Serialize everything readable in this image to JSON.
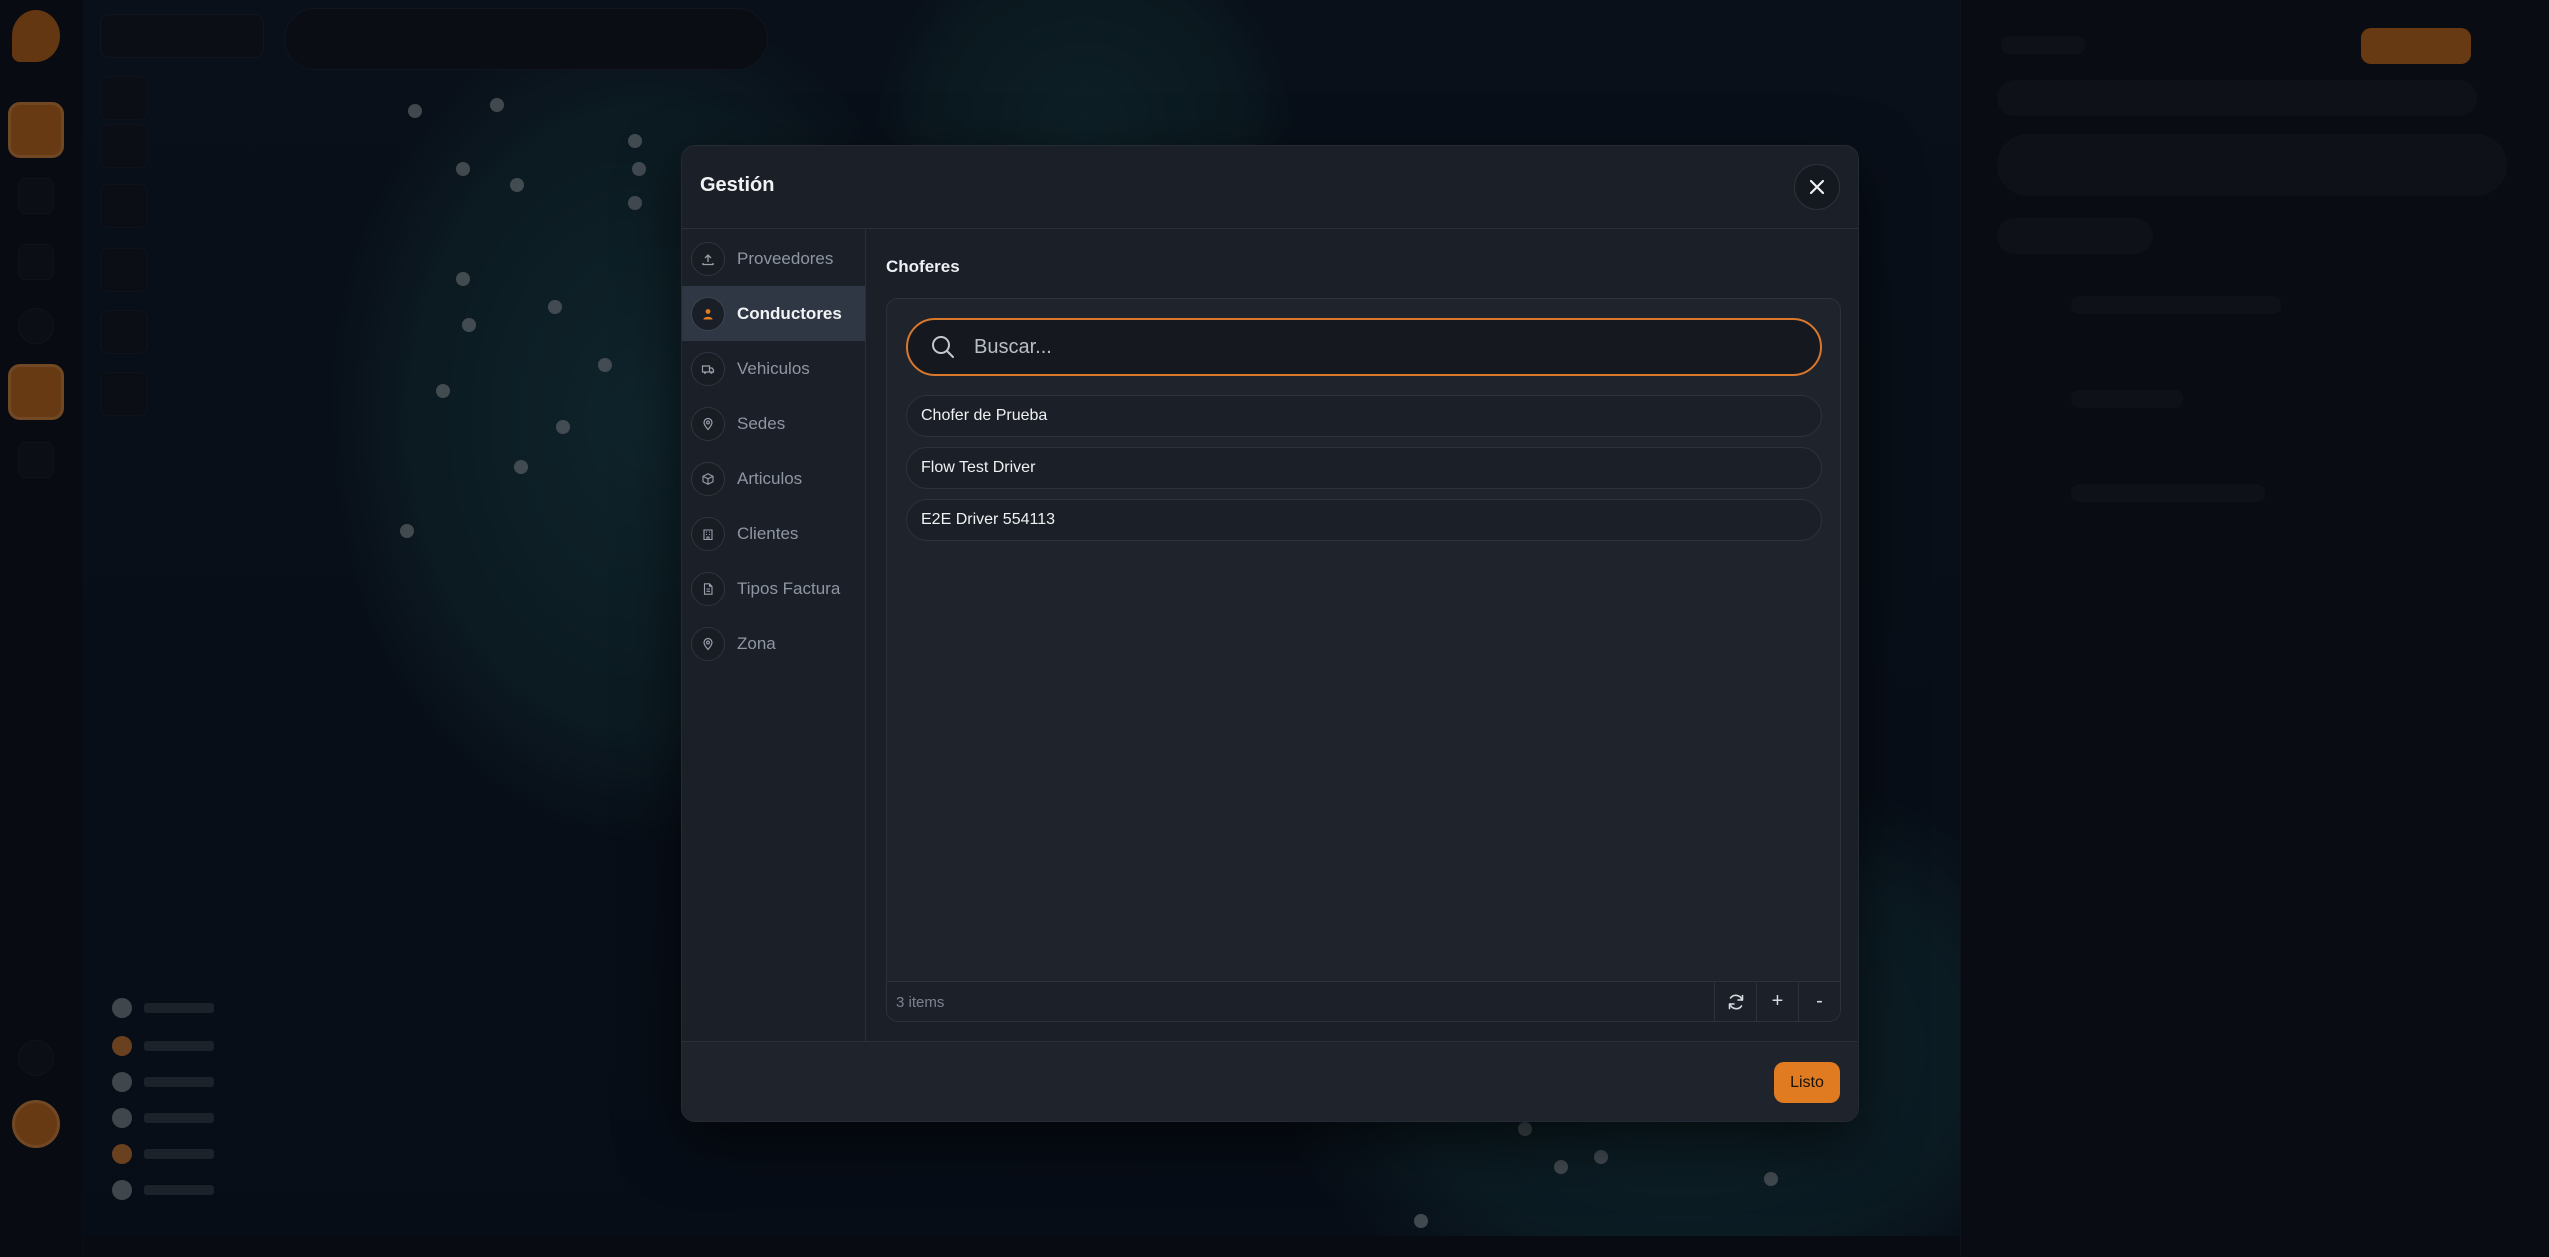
{
  "modal": {
    "title": "Gestión",
    "close_icon": "close-icon",
    "nav": [
      {
        "label": "Proveedores",
        "icon": "upload-icon",
        "active": false
      },
      {
        "label": "Conductores",
        "icon": "person-icon",
        "active": true
      },
      {
        "label": "Vehiculos",
        "icon": "truck-icon",
        "active": false
      },
      {
        "label": "Sedes",
        "icon": "location-pin-icon",
        "active": false
      },
      {
        "label": "Articulos",
        "icon": "box-icon",
        "active": false
      },
      {
        "label": "Clientes",
        "icon": "building-icon",
        "active": false
      },
      {
        "label": "Tipos Factura",
        "icon": "document-icon",
        "active": false
      },
      {
        "label": "Zona",
        "icon": "location-pin-icon",
        "active": false
      }
    ],
    "section_title": "Choferes",
    "search": {
      "placeholder": "Buscar..."
    },
    "items": [
      "Chofer de Prueba",
      "Flow Test Driver",
      "E2E Driver 554113"
    ],
    "footer": {
      "count": "3 items",
      "add": "+",
      "remove": "-"
    },
    "done_label": "Listo"
  },
  "colors": {
    "accent": "#e07b22",
    "modal_bg": "#1b1f27",
    "active_nav": "#2f3745"
  }
}
